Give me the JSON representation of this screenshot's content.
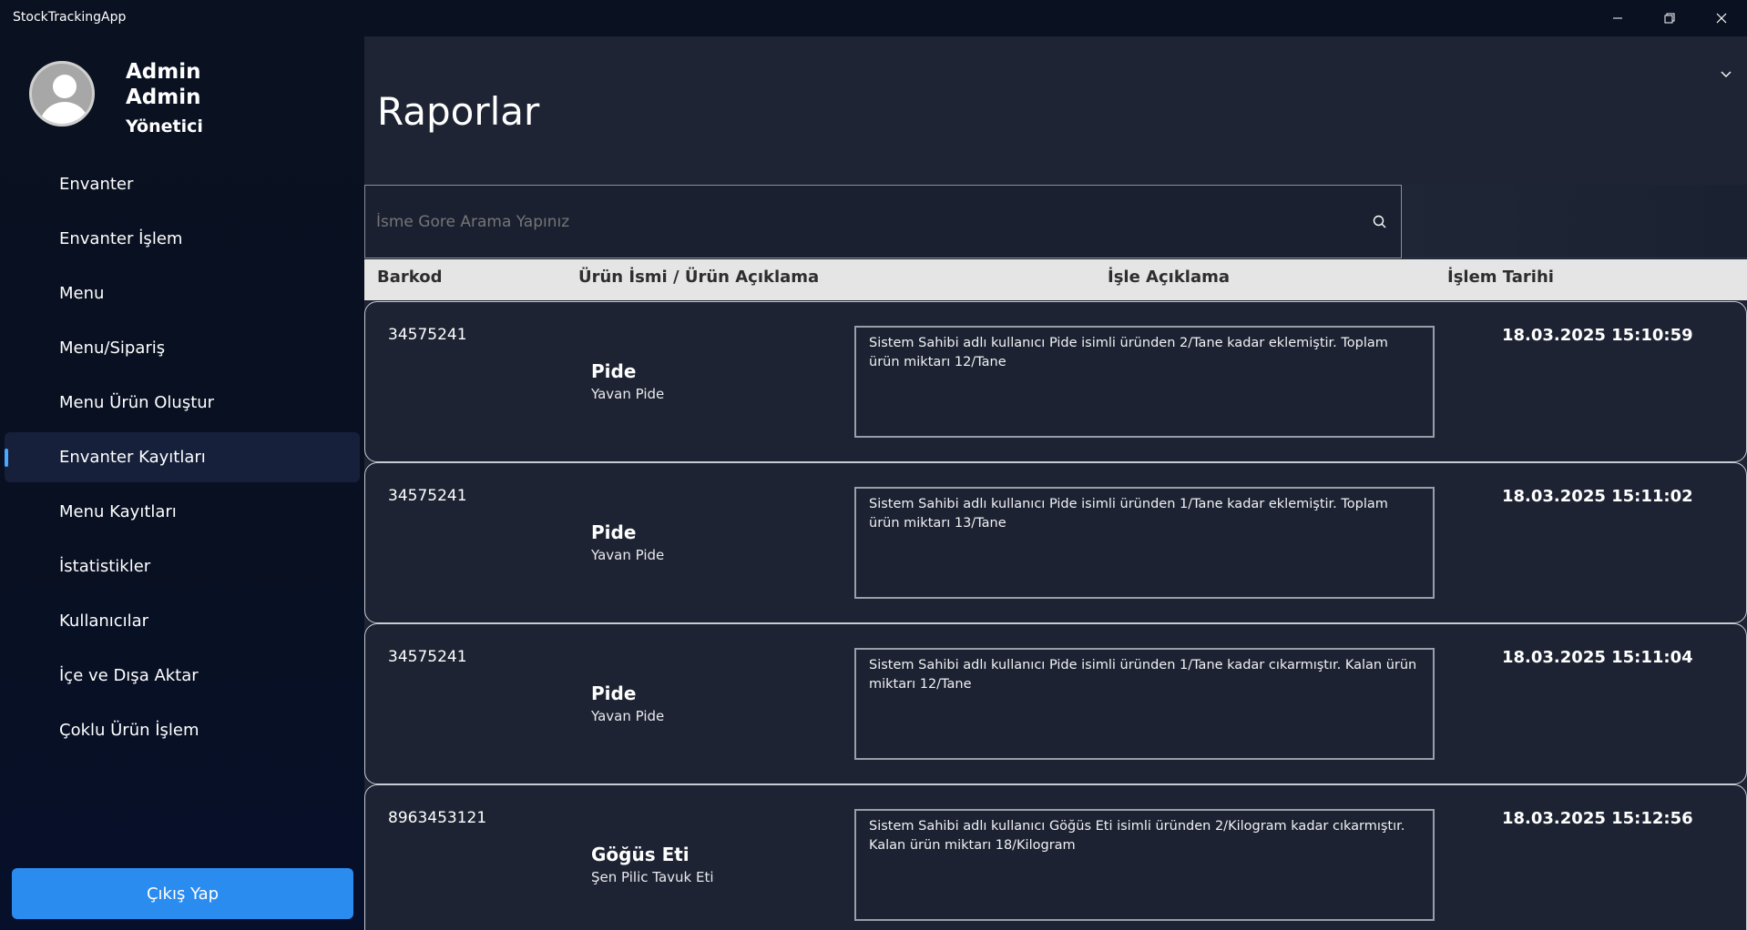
{
  "window": {
    "title": "StockTrackingApp",
    "controls": {
      "minimize": "—",
      "maximize": "❐",
      "close": "✕"
    }
  },
  "user": {
    "first_name": "Admin",
    "last_name": "Admin",
    "role": "Yönetici"
  },
  "sidebar": {
    "items": [
      {
        "label": "Envanter"
      },
      {
        "label": "Envanter İşlem"
      },
      {
        "label": "Menu"
      },
      {
        "label": "Menu/Sipariş"
      },
      {
        "label": "Menu Ürün Oluştur"
      },
      {
        "label": "Envanter Kayıtları"
      },
      {
        "label": "Menu Kayıtları"
      },
      {
        "label": "İstatistikler"
      },
      {
        "label": "Kullanıcılar"
      },
      {
        "label": "İçe ve Dışa Aktar"
      },
      {
        "label": "Çoklu Ürün İşlem"
      }
    ],
    "active_item": "Envanter Kayıtları",
    "logout_label": "Çıkış Yap"
  },
  "main": {
    "title": "Raporlar",
    "search": {
      "placeholder": "İsme Gore Arama Yapınız",
      "value": ""
    },
    "filter": {
      "selected": ""
    },
    "table": {
      "headers": {
        "barkod": "Barkod",
        "urun": "Ürün İsmi / Ürün Açıklama",
        "aciklama": "İşle Açıklama",
        "tarih": "İşlem Tarihi"
      },
      "rows": [
        {
          "barkod": "34575241",
          "name": "Pide",
          "desc": "Yavan Pide",
          "note": "Sistem Sahibi adlı kullanıcı Pide isimli üründen 2/Tane kadar eklemiştir. Toplam ürün miktarı 12/Tane",
          "date": "18.03.2025 15:10:59"
        },
        {
          "barkod": "34575241",
          "name": "Pide",
          "desc": "Yavan Pide",
          "note": "Sistem Sahibi adlı kullanıcı Pide isimli üründen 1/Tane kadar eklemiştir. Toplam ürün miktarı 13/Tane",
          "date": "18.03.2025 15:11:02"
        },
        {
          "barkod": "34575241",
          "name": "Pide",
          "desc": "Yavan Pide",
          "note": "Sistem Sahibi adlı kullanıcı Pide isimli üründen 1/Tane kadar cıkarmıştır. Kalan ürün miktarı 12/Tane",
          "date": "18.03.2025 15:11:04"
        },
        {
          "barkod": "8963453121",
          "name": "Göğüs Eti",
          "desc": "Şen Pilic Tavuk Eti",
          "note": "Sistem Sahibi adlı kullanıcı Göğüs Eti isimli üründen 2/Kilogram kadar cıkarmıştır. Kalan ürün miktarı 18/Kilogram",
          "date": "18.03.2025 15:12:56"
        }
      ]
    }
  },
  "colors": {
    "sidebar_bg": "#0b1220",
    "main_bg": "#1e2433",
    "accent": "#2b8cf0",
    "active_indicator": "#4aa8ff",
    "header_bg": "#e5e5e5"
  },
  "icons": {
    "search": "search-icon",
    "dropdown": "chevron-down-icon",
    "avatar": "user-avatar-icon"
  }
}
